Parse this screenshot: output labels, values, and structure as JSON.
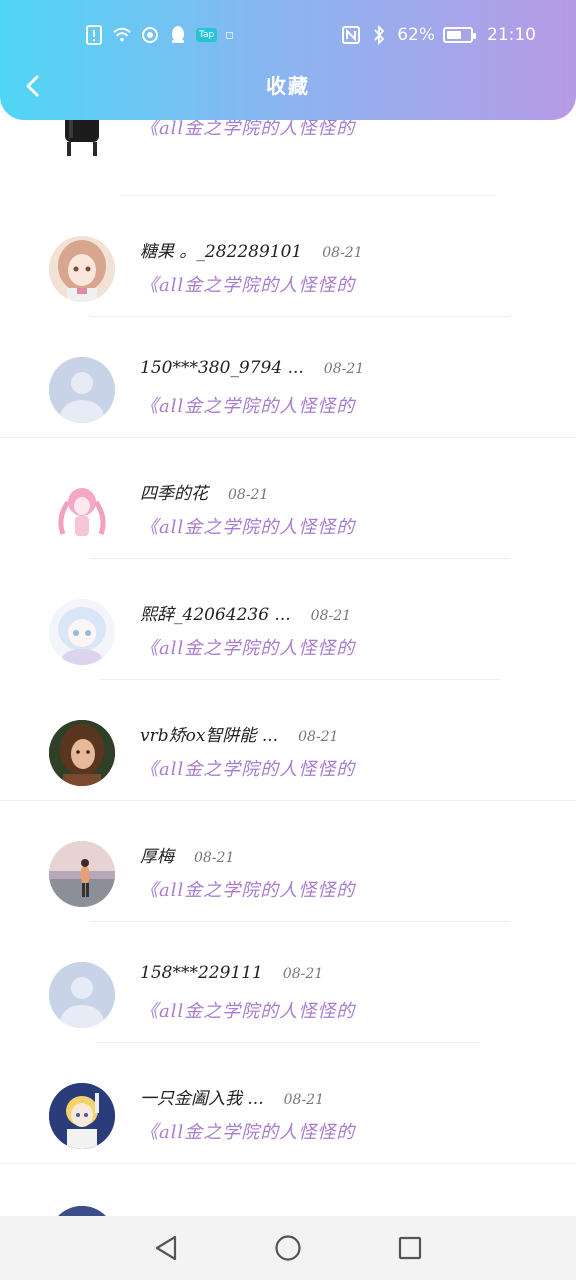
{
  "status_bar": {
    "battery_percent": "62%",
    "battery_level": 0.62,
    "time": "21:10",
    "app_badge": "Tap"
  },
  "header": {
    "title": "收藏",
    "gradient_colors": [
      "#4fd6f5",
      "#b79ae6"
    ]
  },
  "list": {
    "accent_color": "#a87bd0",
    "items": [
      {
        "name": "",
        "date": "",
        "book": "《all金之学院的人怪怪的",
        "avatar": "dark-outfit-avatar"
      },
      {
        "name": "糖果 。_282289101",
        "date": "08-21",
        "book": "《all金之学院的人怪怪的",
        "avatar": "anime-girl-pink-avatar"
      },
      {
        "name": "150***380_9794 ...",
        "date": "08-21",
        "book": "《all金之学院的人怪怪的",
        "avatar": "default-user-avatar"
      },
      {
        "name": "四季的花",
        "date": "08-21",
        "book": "《all金之学院的人怪怪的",
        "avatar": "pink-anime-avatar"
      },
      {
        "name": "熙辞_42064236 ...",
        "date": "08-21",
        "book": "《all金之学院的人怪怪的",
        "avatar": "light-blue-anime-avatar"
      },
      {
        "name": "vrb矫ox智阱能 ...",
        "date": "08-21",
        "book": "《all金之学院的人怪怪的",
        "avatar": "photo-girl-avatar"
      },
      {
        "name": "厚梅",
        "date": "08-21",
        "book": "《all金之学院的人怪怪的",
        "avatar": "landscape-person-avatar"
      },
      {
        "name": "158***229111",
        "date": "08-21",
        "book": "《all金之学院的人怪怪的",
        "avatar": "default-user-avatar"
      },
      {
        "name": "一只金阖入我 ...",
        "date": "08-21",
        "book": "《all金之学院的人怪怪的",
        "avatar": "anime-boy-avatar"
      },
      {
        "name": "",
        "date": "",
        "book": "",
        "avatar": "anime-partial-avatar"
      }
    ]
  }
}
